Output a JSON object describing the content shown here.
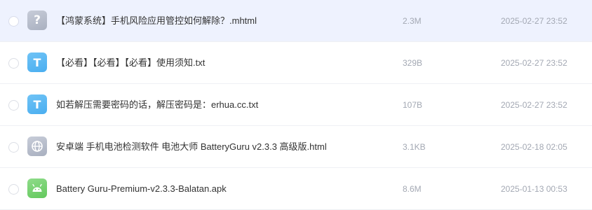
{
  "files": [
    {
      "name": "【鸿蒙系统】手机风险应用管控如何解除？.mhtml",
      "size": "2.3M",
      "date": "2025-02-27 23:52",
      "icon": "unknown-file-icon",
      "icon_glyph": "?"
    },
    {
      "name": "【必看】【必看】【必看】使用须知.txt",
      "size": "329B",
      "date": "2025-02-27 23:52",
      "icon": "text-file-icon",
      "icon_glyph": "T"
    },
    {
      "name": "如若解压需要密码的话，解压密码是：erhua.cc.txt",
      "size": "107B",
      "date": "2025-02-27 23:52",
      "icon": "text-file-icon",
      "icon_glyph": "T"
    },
    {
      "name": "安卓端 手机电池检测软件 电池大师 BatteryGuru v2.3.3 高级版.html",
      "size": "3.1KB",
      "date": "2025-02-18 02:05",
      "icon": "web-file-icon"
    },
    {
      "name": "Battery Guru-Premium-v2.3.3-Balatan.apk",
      "size": "8.6M",
      "date": "2025-01-13 00:53",
      "icon": "android-file-icon"
    }
  ],
  "colors": {
    "selected_row_bg": "#eef2fe",
    "txt_icon": "#4aaef0",
    "apk_icon": "#63c85d",
    "generic_icon": "#a9b0c0",
    "muted_text": "#a3a8b3"
  }
}
